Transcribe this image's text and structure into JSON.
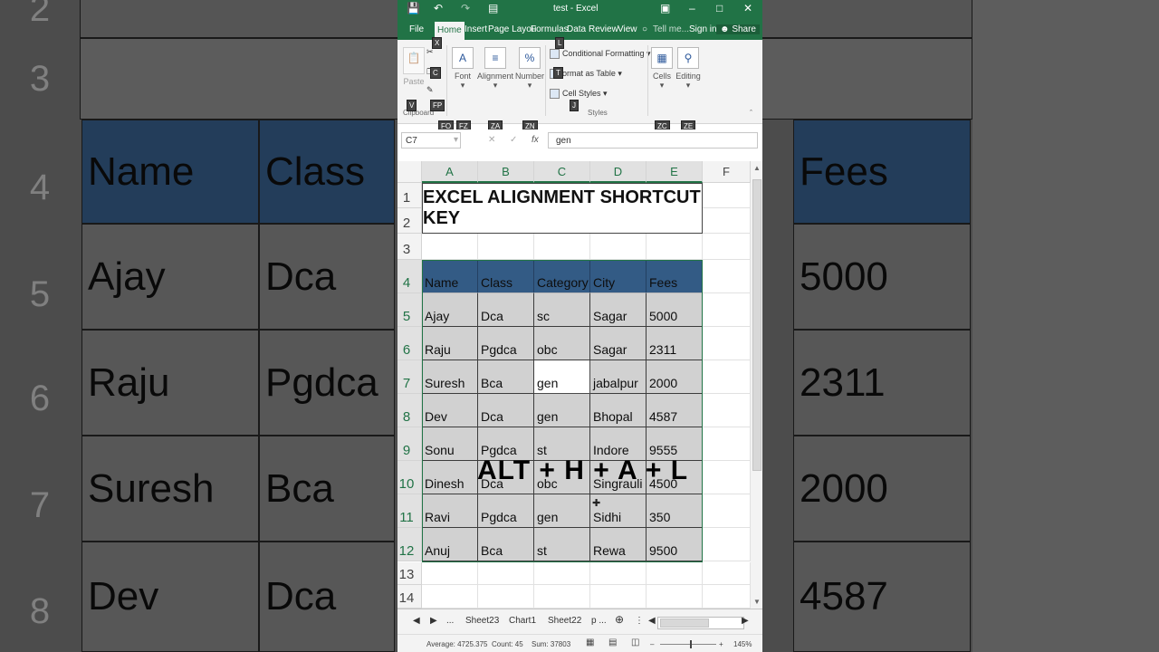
{
  "window": {
    "title": "test - Excel"
  },
  "tabs": [
    "File",
    "Home",
    "Insert",
    "Page Layou",
    "Formulas",
    "Data",
    "Review",
    "View"
  ],
  "tell_me": "Tell me...",
  "sign_in": "Sign in",
  "share": "Share",
  "keytips": {
    "file_x": "X",
    "copy_c": "C",
    "format_painter_fp": "FP",
    "cond_l": "L",
    "table_t": "T",
    "styles_j": "J",
    "v": "V",
    "fo": "FO",
    "fz": "FZ",
    "za": "ZA",
    "zn": "ZN",
    "zc": "ZC",
    "ze": "ZE"
  },
  "ribbon": {
    "paste": "Paste",
    "clipboard": "Clipboard",
    "font": "Font",
    "alignment": "Alignment",
    "number": "Number",
    "conditional_formatting": "Conditional Formatting",
    "format_as_table": "ormat as Table",
    "cell_styles": "Cell Styles",
    "styles": "Styles",
    "cells": "Cells",
    "editing": "Editing"
  },
  "formula_bar": {
    "name_box": "C7",
    "content": "gen"
  },
  "columns": [
    "A",
    "B",
    "C",
    "D",
    "E",
    "F"
  ],
  "rows": [
    "1",
    "2",
    "3",
    "4",
    "5",
    "6",
    "7",
    "8",
    "9",
    "10",
    "11",
    "12",
    "13",
    "14"
  ],
  "sheet_title": "EXCEL ALIGNMENT SHORTCUT KEY",
  "headers": [
    "Name",
    "Class",
    "Category",
    "City",
    "Fees"
  ],
  "data_rows": [
    [
      "Ajay",
      "Dca",
      "sc",
      "Sagar",
      "5000"
    ],
    [
      "Raju",
      "Pgdca",
      "obc",
      "Sagar",
      "2311"
    ],
    [
      "Suresh",
      "Bca",
      "gen",
      "jabalpur",
      "2000"
    ],
    [
      "Dev",
      "Dca",
      "gen",
      "Bhopal",
      "4587"
    ],
    [
      "Sonu",
      "Pgdca",
      "st",
      "Indore",
      "9555"
    ],
    [
      "Dinesh",
      "Dca",
      "obc",
      "Singrauli",
      "4500"
    ],
    [
      "Ravi",
      "Pgdca",
      "gen",
      "Sidhi",
      "350"
    ],
    [
      "Anuj",
      "Bca",
      "st",
      "Rewa",
      "9500"
    ]
  ],
  "overlay_text": "ALT + H + A + L",
  "sheet_tabs": [
    "...",
    "Sheet23",
    "Chart1",
    "Sheet22",
    "p ..."
  ],
  "status": {
    "average": "Average: 4725.375",
    "count": "Count: 45",
    "sum": "Sum: 37803",
    "zoom": "145%"
  },
  "background": {
    "rows": [
      "2",
      "3",
      "4",
      "5",
      "6",
      "7",
      "8"
    ],
    "headers": [
      "Name",
      "Class",
      "Fees"
    ],
    "data": [
      [
        "Ajay",
        "Dca",
        "5000"
      ],
      [
        "Raju",
        "Pgdca",
        "2311"
      ],
      [
        "Suresh",
        "Bca",
        "2000"
      ],
      [
        "Dev",
        "Dca",
        "4587"
      ]
    ]
  },
  "colors": {
    "excel_green": "#217346",
    "header_blue": "#3f6fa3"
  }
}
